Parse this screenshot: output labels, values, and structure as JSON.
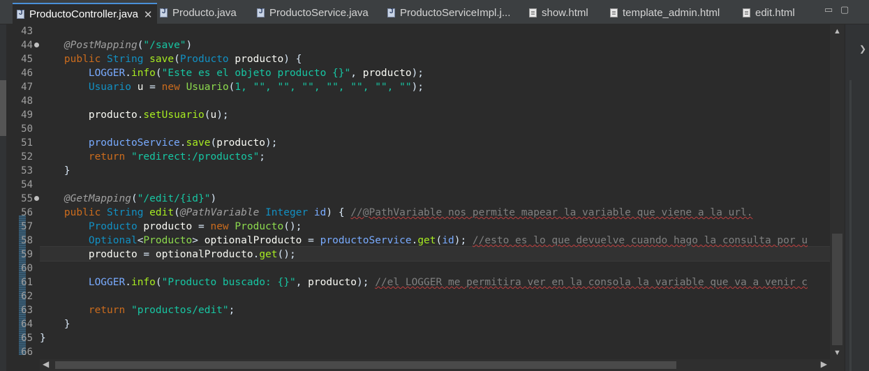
{
  "tabs": [
    {
      "label": "ProductoController.java",
      "type": "java",
      "active": true
    },
    {
      "label": "Producto.java",
      "type": "java",
      "active": false
    },
    {
      "label": "ProductoService.java",
      "type": "java",
      "active": false
    },
    {
      "label": "ProductoServiceImpl.j...",
      "type": "java",
      "active": false
    },
    {
      "label": "show.html",
      "type": "html",
      "active": false
    },
    {
      "label": "template_admin.html",
      "type": "html",
      "active": false
    },
    {
      "label": "edit.html",
      "type": "html",
      "active": false
    }
  ],
  "close_glyph": "✕",
  "window_controls": {
    "minimize": "▭",
    "maximize": "▢"
  },
  "icons": {
    "java_file": "java-file-icon",
    "html_file": "html-file-icon",
    "fold_marker": "fold-marker-icon"
  },
  "line_numbers": [
    "43",
    "44",
    "45",
    "46",
    "47",
    "48",
    "49",
    "50",
    "51",
    "52",
    "53",
    "54",
    "55",
    "56",
    "57",
    "58",
    "59",
    "60",
    "61",
    "62",
    "63",
    "64",
    "65",
    "66"
  ],
  "fold_markers": [
    "44",
    "55"
  ],
  "current_line": "59",
  "code": {
    "l44_ann": "@PostMapping",
    "l44_str": "\"/save\"",
    "l45_kw": "public",
    "l45_type": "String",
    "l45_method": "save",
    "l45_ptype": "Producto",
    "l45_param": "producto",
    "l46_logger": "LOGGER",
    "l46_info": "info",
    "l46_str": "\"Este es el objeto producto {}\"",
    "l46_arg": "producto",
    "l47_type": "Usuario",
    "l47_var": "u",
    "l47_new": "new",
    "l47_ctor": "Usuario",
    "l47_args": "1, \"\", \"\", \"\", \"\", \"\", \"\", \"\"",
    "l49_obj": "producto",
    "l49_call": "setUsuario",
    "l49_arg": "u",
    "l51_obj": "productoService",
    "l51_call": "save",
    "l51_arg": "producto",
    "l52_kw": "return",
    "l52_str": "\"redirect:/productos\"",
    "l55_ann": "@GetMapping",
    "l55_str": "\"/edit/{id}\"",
    "l56_kw": "public",
    "l56_type": "String",
    "l56_method": "edit",
    "l56_pann": "@PathVariable",
    "l56_ptype": "Integer",
    "l56_param": "id",
    "l56_comment": "//@PathVariable nos permite mapear la variable que viene a la url.",
    "l57_type": "Producto",
    "l57_var": "producto",
    "l57_new": "new",
    "l57_ctor": "Producto",
    "l58_type": "Optional",
    "l58_gtype": "Producto",
    "l58_var": "optionalProducto",
    "l58_obj": "productoService",
    "l58_call": "get",
    "l58_arg": "id",
    "l58_comment": "//esto es lo que devuelve cuando hago la consulta por u",
    "l59_var": "producto",
    "l59_obj": "optionalProducto",
    "l59_call": "get",
    "l61_logger": "LOGGER",
    "l61_info": "info",
    "l61_str": "\"Producto buscado: {}\"",
    "l61_arg": "producto",
    "l61_comment": "//el LOGGER me permitira ver en la consola la variable que va a venir c",
    "l63_kw": "return",
    "l63_str": "\"productos/edit\""
  },
  "colors": {
    "background": "#2b2b2b",
    "keyword": "#cc6c1d",
    "type": "#1290c3",
    "method": "#a7ec21",
    "string": "#17c6a3",
    "field": "#8dda4e",
    "comment": "#808080",
    "tab_accent": "#4a90d9"
  }
}
